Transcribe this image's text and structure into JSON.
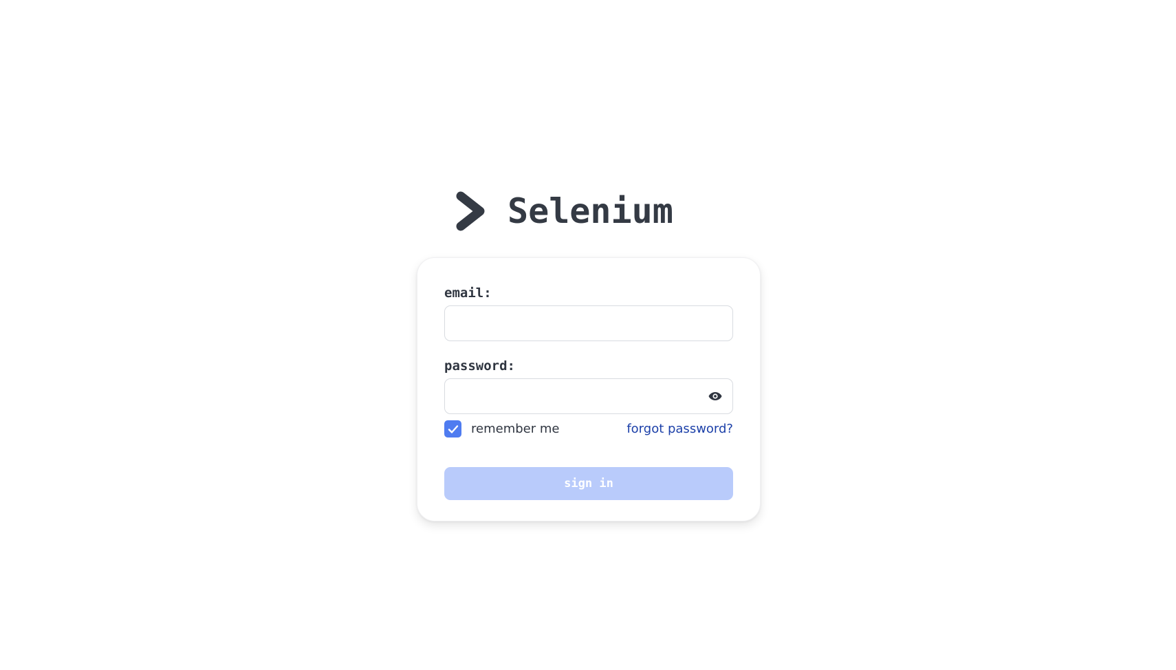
{
  "brand": {
    "name": "Selenium",
    "logo_icon": "chevron-right-icon",
    "color": "#343a44"
  },
  "form": {
    "email": {
      "label": "email:",
      "value": "",
      "placeholder": ""
    },
    "password": {
      "label": "password:",
      "value": "",
      "placeholder": "",
      "toggle_icon": "eye-icon"
    },
    "remember": {
      "label": "remember me",
      "checked": true,
      "icon": "checkmark-icon",
      "color": "#4f7cf0"
    },
    "forgot": {
      "label": "forgot password?",
      "color": "#1b3fa8"
    },
    "submit": {
      "label": "sign in",
      "color": "#b9cbfb"
    }
  }
}
